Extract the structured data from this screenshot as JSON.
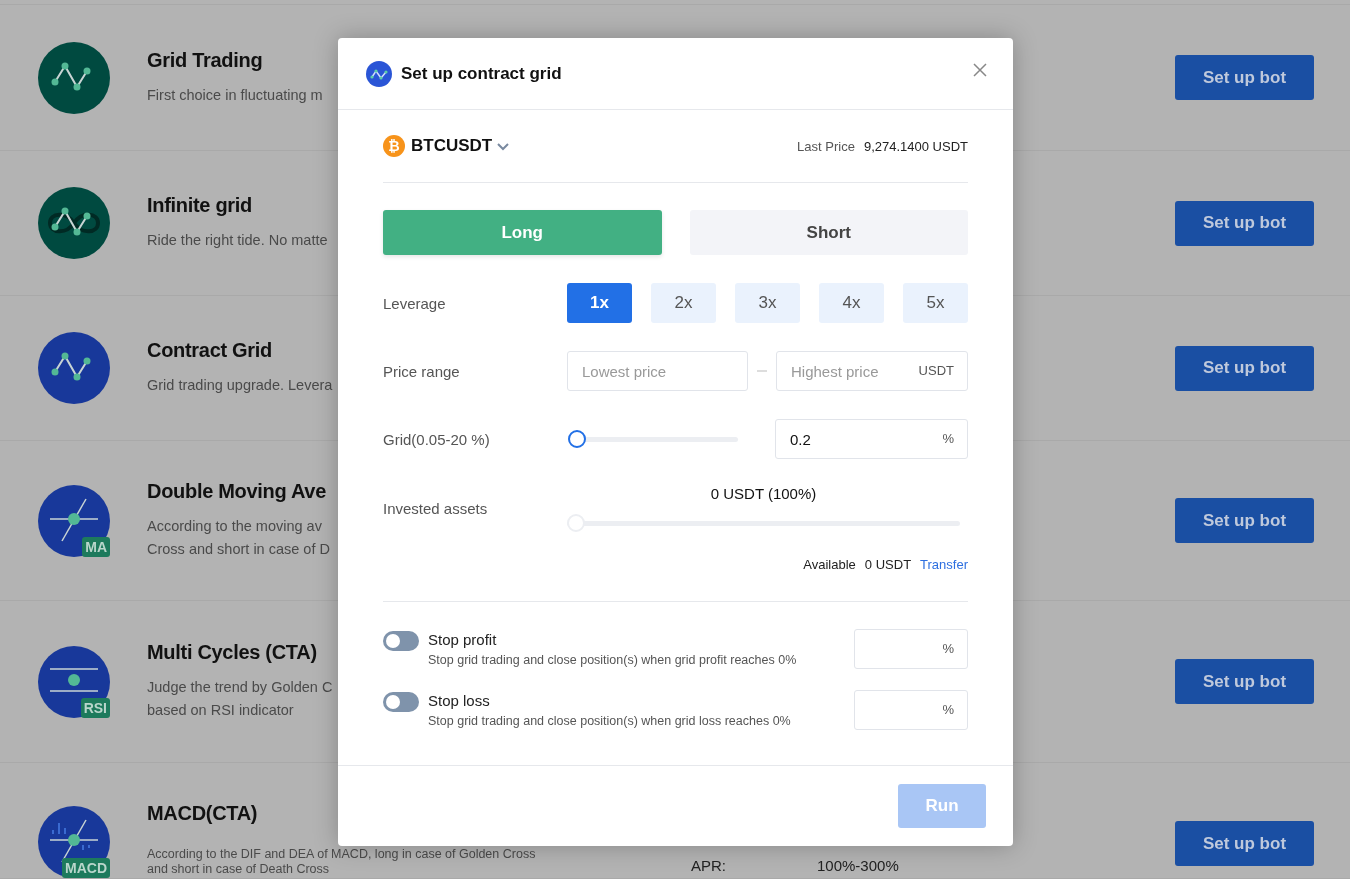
{
  "bots": [
    {
      "title": "Grid Trading",
      "kind": "grid",
      "color": "#004a40",
      "description": [
        "First choice in fluctuating m"
      ],
      "button": "Set up bot"
    },
    {
      "title": "Infinite grid",
      "kind": "infinite",
      "color": "#004a40",
      "description": [
        "Ride the right tide. No matte"
      ],
      "button": "Set up bot"
    },
    {
      "title": "Contract Grid",
      "kind": "grid",
      "color": "#18389a",
      "description": [
        "Grid trading upgrade. Levera"
      ],
      "button": "Set up bot"
    },
    {
      "title": "Double Moving Ave",
      "kind": "ma",
      "color": "#18389a",
      "badge": "MA",
      "description": [
        "According to the moving av",
        "Cross and short in case of D"
      ],
      "button": "Set up bot"
    },
    {
      "title": "Multi Cycles (CTA)",
      "kind": "rsi",
      "color": "#18389a",
      "badge": "RSI",
      "description": [
        "Judge the trend by Golden C",
        "based on RSI indicator"
      ],
      "button": "Set up bot"
    },
    {
      "title": "MACD(CTA)",
      "kind": "macd",
      "color": "#18389a",
      "badge": "MACD",
      "description": [
        "According to the DIF and DEA of MACD, long in case of Golden Cross",
        "and short in case of Death Cross"
      ],
      "stats": [
        {
          "label": "APR:",
          "value": "100%-300%"
        }
      ],
      "button": "Set up bot"
    }
  ],
  "dialog": {
    "title": "Set up contract grid",
    "symbol": {
      "coin_glyph": "₿",
      "name": "BTCUSDT"
    },
    "last_price": {
      "label": "Last Price",
      "value": "9,274.1400 USDT"
    },
    "sides": [
      {
        "label": "Long",
        "selected": true
      },
      {
        "label": "Short",
        "selected": false
      }
    ],
    "leverage": {
      "label": "Leverage",
      "options": [
        {
          "label": "1x",
          "selected": true
        },
        {
          "label": "2x",
          "selected": false
        },
        {
          "label": "3x",
          "selected": false
        },
        {
          "label": "4x",
          "selected": false
        },
        {
          "label": "5x",
          "selected": false
        }
      ]
    },
    "price_range": {
      "label": "Price range",
      "low": {
        "placeholder": "Lowest price"
      },
      "high": {
        "placeholder": "Highest price",
        "unit": "USDT"
      }
    },
    "grid": {
      "label": "Grid(0.05-20 %)",
      "level": 0,
      "value": "0.2",
      "unit": "%"
    },
    "invested": {
      "label": "Invested assets",
      "amount": "0 USDT (100%)",
      "level": 0,
      "available_label": "Available",
      "available": "0 USDT",
      "transfer": "Transfer"
    },
    "stops": [
      {
        "label": "Stop profit",
        "on": false,
        "description": "Stop grid trading and close position(s) when grid profit reaches 0%",
        "unit": "%"
      },
      {
        "label": "Stop loss",
        "on": false,
        "description": "Stop grid trading and close position(s) when grid loss reaches 0%",
        "unit": "%"
      }
    ],
    "run": {
      "label": "Run",
      "disabled": true
    }
  }
}
